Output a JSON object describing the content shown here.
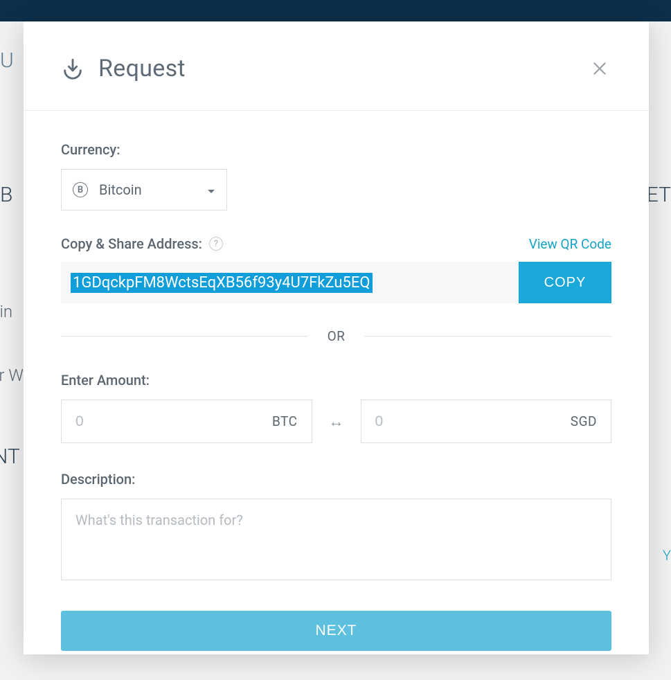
{
  "background": {
    "fragments": {
      "u": "U",
      "b": "B",
      "et": "ET",
      "oin": "oin",
      "erw": "er W",
      "nt": "NT",
      "y": "Y"
    }
  },
  "modal": {
    "title": "Request",
    "currency": {
      "label": "Currency:",
      "selected": "Bitcoin"
    },
    "address": {
      "label": "Copy & Share Address:",
      "value": "1GDqckpFM8WctsEqXB56f93y4U7FkZu5EQ",
      "qr_link": "View QR Code",
      "copy_label": "COPY"
    },
    "divider": "OR",
    "amount": {
      "label": "Enter Amount:",
      "crypto_placeholder": "0",
      "crypto_suffix": "BTC",
      "fiat_placeholder": "0",
      "fiat_suffix": "SGD"
    },
    "description": {
      "label": "Description:",
      "placeholder": "What's this transaction for?"
    },
    "next_label": "NEXT"
  }
}
